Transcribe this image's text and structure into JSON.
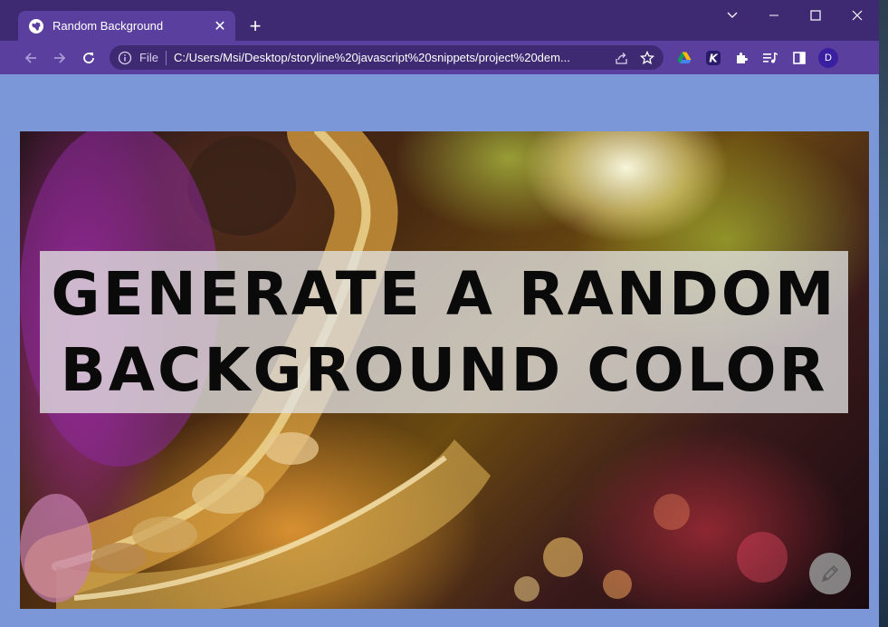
{
  "browser": {
    "tab": {
      "title": "Random Background",
      "icon": "globe-icon"
    },
    "new_tab_label": "+",
    "window_controls": [
      "chevron-down-icon",
      "minimize-icon",
      "maximize-icon",
      "close-icon"
    ],
    "address_bar": {
      "scheme_label": "File",
      "url": "C:/Users/Msi/Desktop/storyline%20javascript%20snippets/project%20dem..."
    },
    "profile_initial": "D",
    "colors": {
      "titlebar": "#3d2a72",
      "toolbar": "#5a3f9f",
      "page_background": "#7b97d8"
    }
  },
  "page": {
    "heading": {
      "line1": "GENERATE A RANDOM",
      "line2": "BACKGROUND COLOR"
    },
    "hero_image": "saxophone-concert-photo",
    "floating_button_icon": "pen-icon"
  }
}
